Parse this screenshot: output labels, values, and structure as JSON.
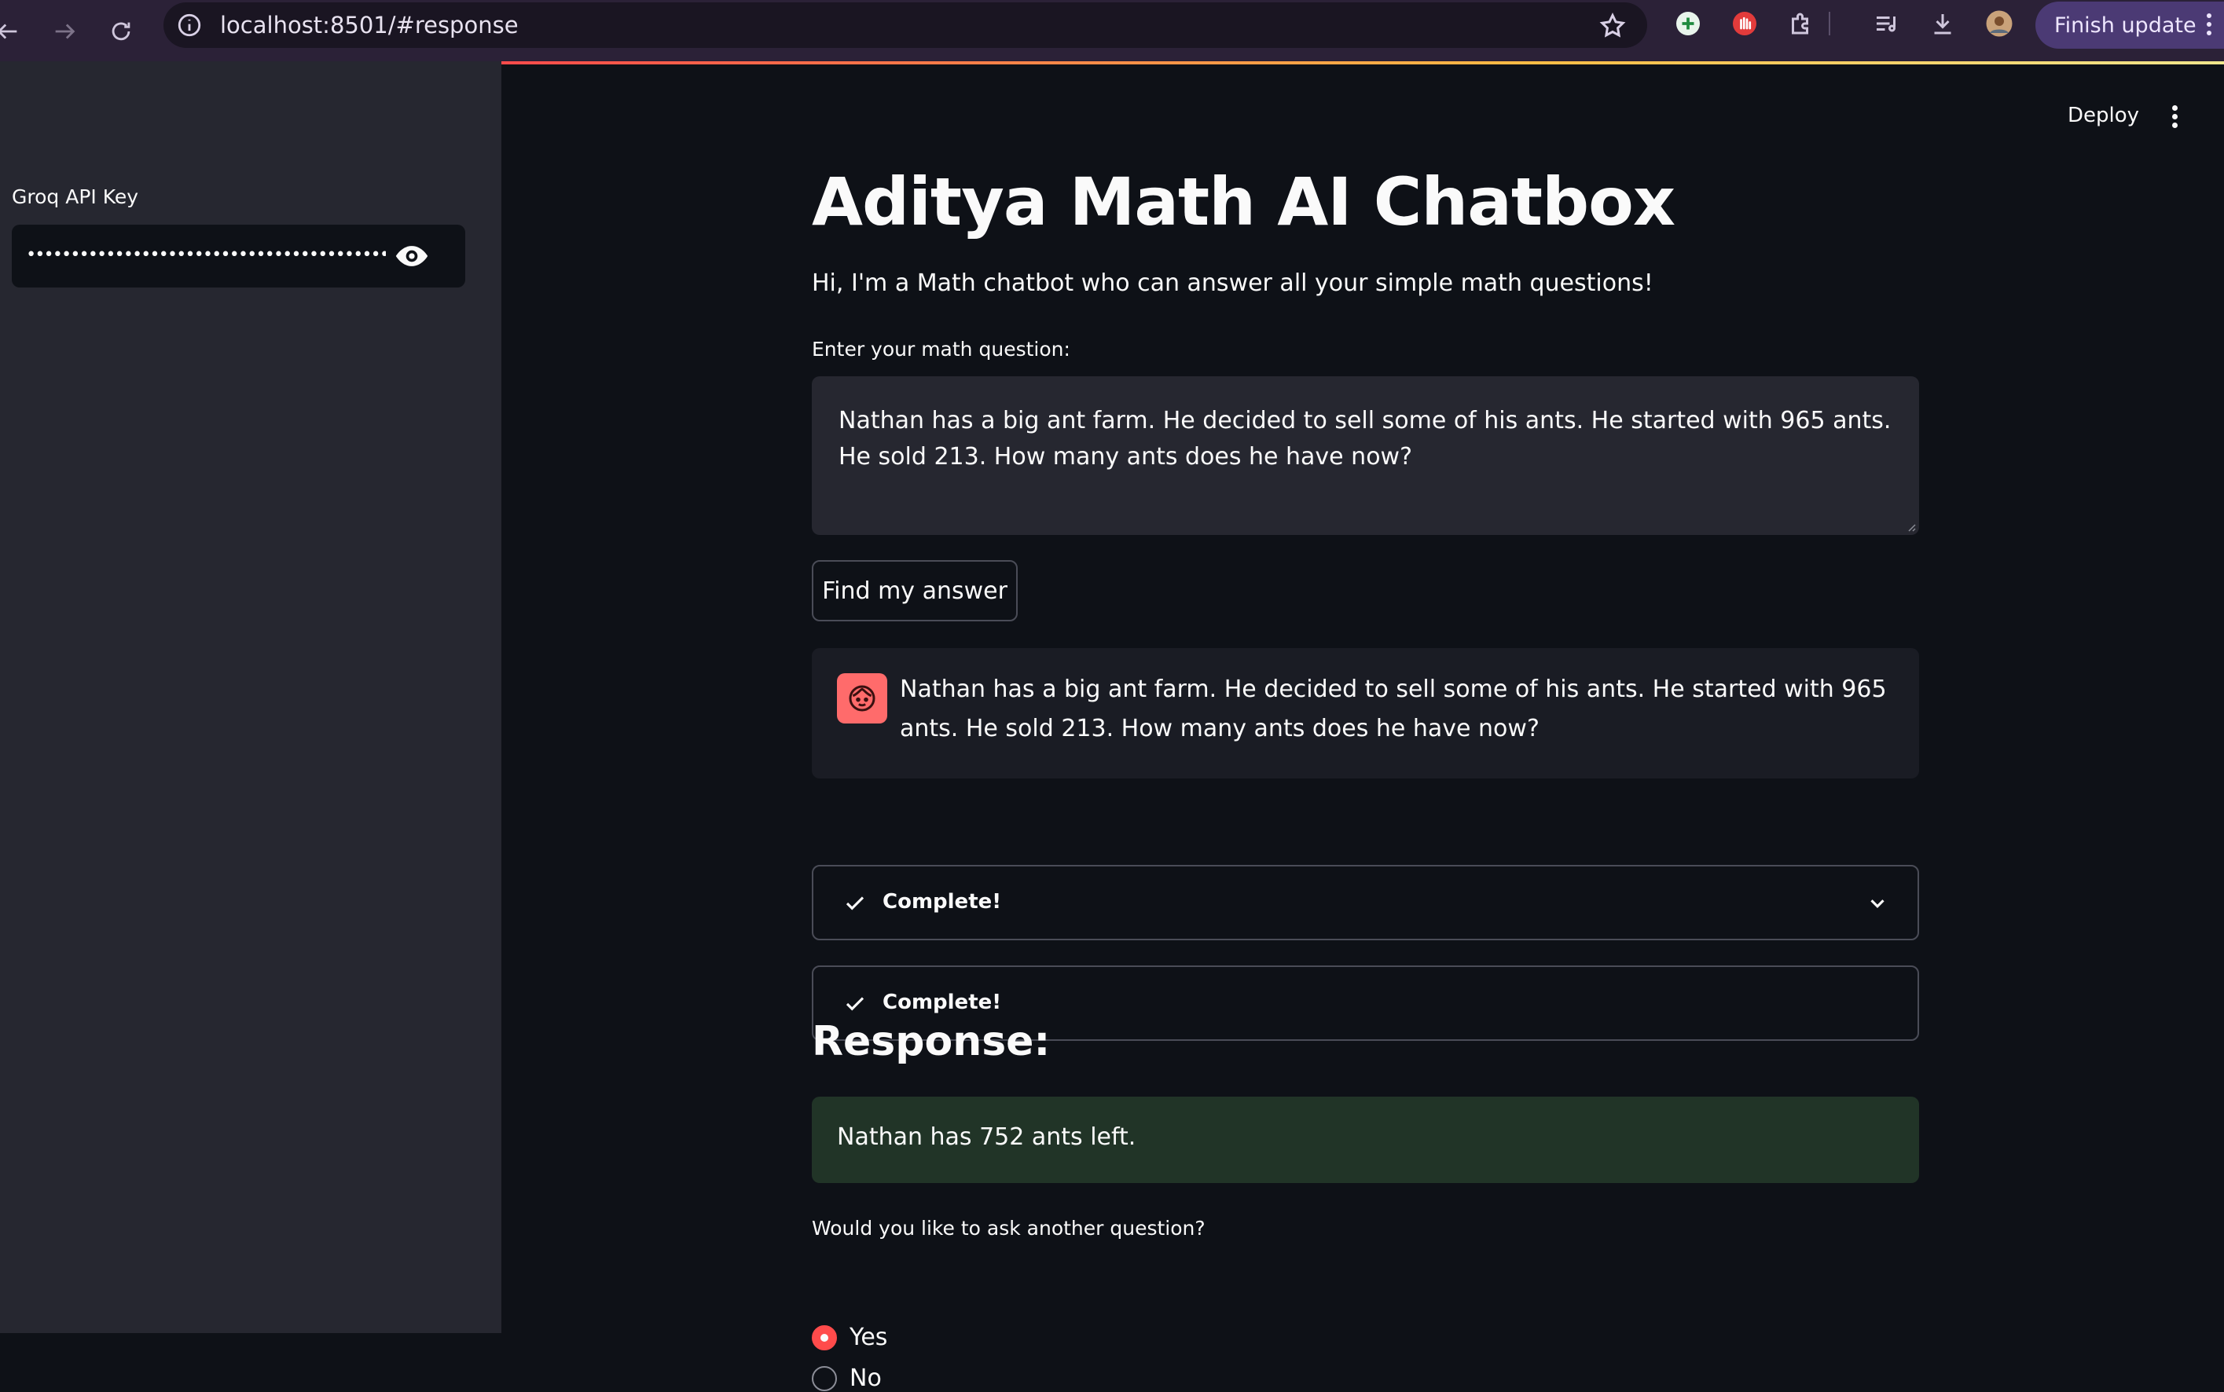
{
  "browser": {
    "url": "localhost:8501/#response",
    "finish_update_label": "Finish update"
  },
  "sidebar": {
    "api_key_label": "Groq API Key",
    "api_key_masked": "••••••••••••••••••••••••••••••••••••••••••••••••••••••"
  },
  "header": {
    "deploy_label": "Deploy"
  },
  "main": {
    "title": "Aditya Math AI Chatbox",
    "subtitle": "Hi, I'm a Math chatbot who can answer all your simple math questions!",
    "question_label": "Enter your math question:",
    "question_value": "Nathan has a big ant farm. He decided to sell some of his ants. He started with 965 ants. He sold 213. How many ants does he have now?",
    "find_button_label": "Find my answer",
    "chat_message": "Nathan has a big ant farm. He decided to sell some of his ants. He started with 965 ants. He sold 213. How many ants does he have now?",
    "status_items": [
      {
        "label": "Complete!",
        "expandable": true
      },
      {
        "label": "Complete!",
        "expandable": false
      }
    ],
    "response_heading": "Response:",
    "response_text": "Nathan has 752 ants left.",
    "another_question_label": "Would you like to ask another question?",
    "options": [
      {
        "label": "Yes",
        "selected": true
      },
      {
        "label": "No",
        "selected": false
      }
    ]
  },
  "colors": {
    "accent": "#ff4b4b",
    "sidebar_bg": "#262730",
    "main_bg": "#0e1117",
    "success_bg": "#213427",
    "browser_bar": "#2b2137"
  }
}
